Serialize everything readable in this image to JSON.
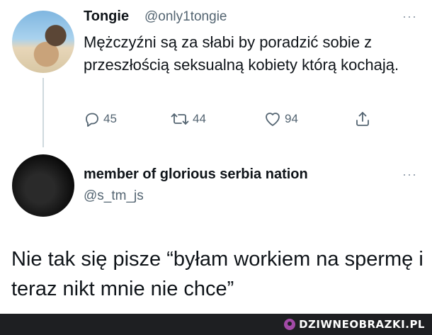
{
  "tweet1": {
    "author_name": "Tongie",
    "author_handle": "@only1tongie",
    "text": "Mężczyźni są za słabi by poradzić sobie z przeszłością seksualną kobiety którą kochają.",
    "actions": {
      "reply_count": "45",
      "retweet_count": "44",
      "like_count": "94"
    }
  },
  "tweet2": {
    "author_name": "member of glorious serbia nation",
    "author_handle": "@s_tm_js",
    "text": "Nie tak się pisze “byłam workiem na spermę i teraz nikt mnie nie chce”"
  },
  "watermark": {
    "text": "DZIWNEOBRAZKI.PL"
  },
  "colors": {
    "text_primary": "#0f1419",
    "text_secondary": "#536471",
    "thread_line": "#cfd9de",
    "footer_bg": "#1e1f22",
    "logo_accent": "#a24aa6"
  },
  "icons": {
    "reply": "reply-icon",
    "retweet": "retweet-icon",
    "like": "heart-icon",
    "share": "share-icon",
    "more": "more-icon"
  }
}
